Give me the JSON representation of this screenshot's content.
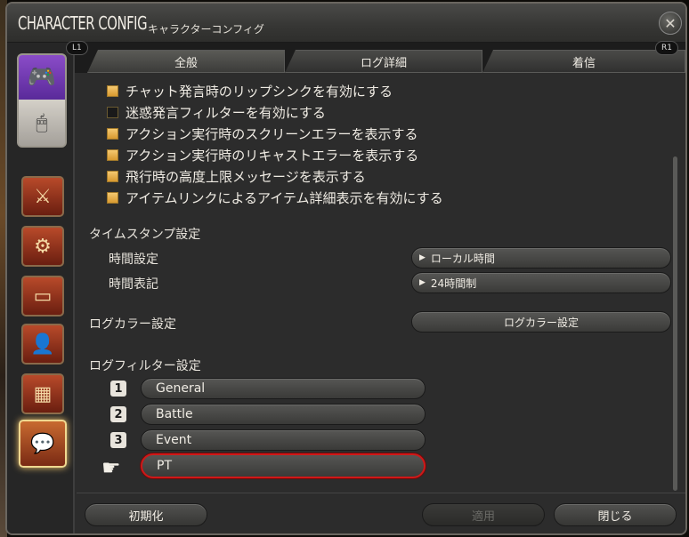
{
  "window": {
    "title": "CHARACTER CONFIG",
    "subtitle": "キャラクターコンフィグ",
    "close_icon": "close-icon"
  },
  "tabs": {
    "left_hint": "L1",
    "right_hint": "R1",
    "items": [
      {
        "label": "全般",
        "selected": true
      },
      {
        "label": "ログ詳細",
        "selected": false
      },
      {
        "label": "着信",
        "selected": false
      }
    ]
  },
  "sidebar": {
    "mode_icons": [
      "gamepad-icon",
      "mouse-icon"
    ],
    "categories": [
      "crossed-swords-icon",
      "gears-icon",
      "id-card-icon",
      "character-icon",
      "checkered-icon",
      "chat-log-icon"
    ],
    "active_category": "chat-log-icon"
  },
  "options": [
    {
      "label": "チャット発言時のリップシンクを有効にする",
      "checked": true
    },
    {
      "label": "迷惑発言フィルターを有効にする",
      "checked": false
    },
    {
      "label": "アクション実行時のスクリーンエラーを表示する",
      "checked": true
    },
    {
      "label": "アクション実行時のリキャストエラーを表示する",
      "checked": true
    },
    {
      "label": "飛行時の高度上限メッセージを表示する",
      "checked": true
    },
    {
      "label": "アイテムリンクによるアイテム詳細表示を有効にする",
      "checked": true
    }
  ],
  "timestamp": {
    "heading": "タイムスタンプ設定",
    "time_setting_label": "時間設定",
    "time_setting_value": "ローカル時間",
    "time_format_label": "時間表記",
    "time_format_value": "24時間制"
  },
  "log_color": {
    "heading": "ログカラー設定",
    "button_label": "ログカラー設定"
  },
  "log_filter": {
    "heading": "ログフィルター設定",
    "filters": [
      {
        "number": "1",
        "label": "General"
      },
      {
        "number": "2",
        "label": "Battle"
      },
      {
        "number": "3",
        "label": "Event"
      },
      {
        "number": "",
        "label": "PT",
        "selected": true
      }
    ]
  },
  "footer": {
    "reset_label": "初期化",
    "apply_label": "適用",
    "close_label": "閉じる"
  }
}
